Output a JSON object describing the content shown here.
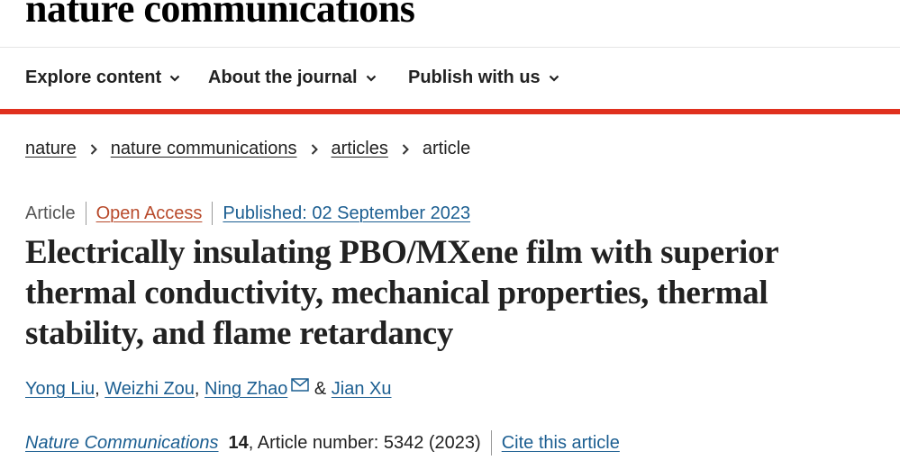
{
  "masthead": {
    "logo": "nature communications"
  },
  "nav": {
    "items": [
      {
        "label": "Explore content"
      },
      {
        "label": "About the journal"
      },
      {
        "label": "Publish with us"
      }
    ]
  },
  "colors": {
    "accent_bar": "#e0301e",
    "link": "#1b5e91",
    "open_access": "#b84a2b"
  },
  "breadcrumb": {
    "items": [
      {
        "label": "nature"
      },
      {
        "label": "nature communications"
      },
      {
        "label": "articles"
      }
    ],
    "current": "article"
  },
  "article": {
    "type": "Article",
    "access": "Open Access",
    "published": "Published: 02 September 2023",
    "title": "Electrically insulating PBO/MXene film with superior thermal conductivity, mechanical properties, thermal stability, and flame retardancy",
    "authors": [
      "Yong Liu",
      "Weizhi Zou",
      "Ning Zhao",
      "Jian Xu"
    ],
    "author_sep": ",",
    "author_and": "&",
    "corresponding_icon": "mail-icon",
    "citation": {
      "journal": "Nature Communications",
      "volume": "14",
      "article_number": ", Article number: 5342 (2023)",
      "cite_label": "Cite this article"
    }
  }
}
